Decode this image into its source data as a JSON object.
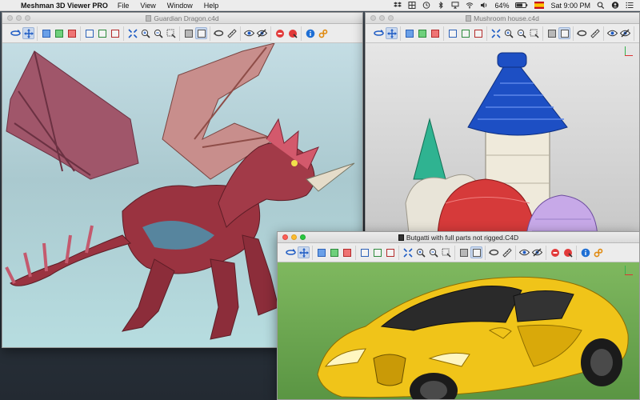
{
  "menubar": {
    "app_name": "Meshman 3D Viewer PRO",
    "menus": [
      "File",
      "View",
      "Window",
      "Help"
    ],
    "battery": "64%",
    "clock": "Sat 9:00 PM"
  },
  "windows": [
    {
      "title": "Guardian Dragon.c4d",
      "active": false,
      "model": "dragon",
      "background": "#b9d6dc"
    },
    {
      "title": "Mushroom house.c4d",
      "active": false,
      "model": "mushroom-house",
      "background": "#d3d3d3"
    },
    {
      "title": "Butgatti with full parts not rigged.C4D",
      "active": true,
      "model": "car",
      "background": "#5e9a47"
    }
  ],
  "toolbar": {
    "tools": [
      "orbit-icon",
      "pan-icon",
      "front-view-icon",
      "top-view-icon",
      "side-view-icon",
      "view-cube-1-icon",
      "view-cube-2-icon",
      "view-cube-3-icon",
      "fit-all-icon",
      "zoom-in-icon",
      "zoom-out-icon",
      "zoom-region-icon",
      "shaded-icon",
      "wireframe-icon",
      "rotate-icon",
      "measure-icon",
      "visible-icon",
      "hide-icon",
      "record-icon",
      "snapshot-icon",
      "info-icon",
      "settings-icon"
    ]
  }
}
